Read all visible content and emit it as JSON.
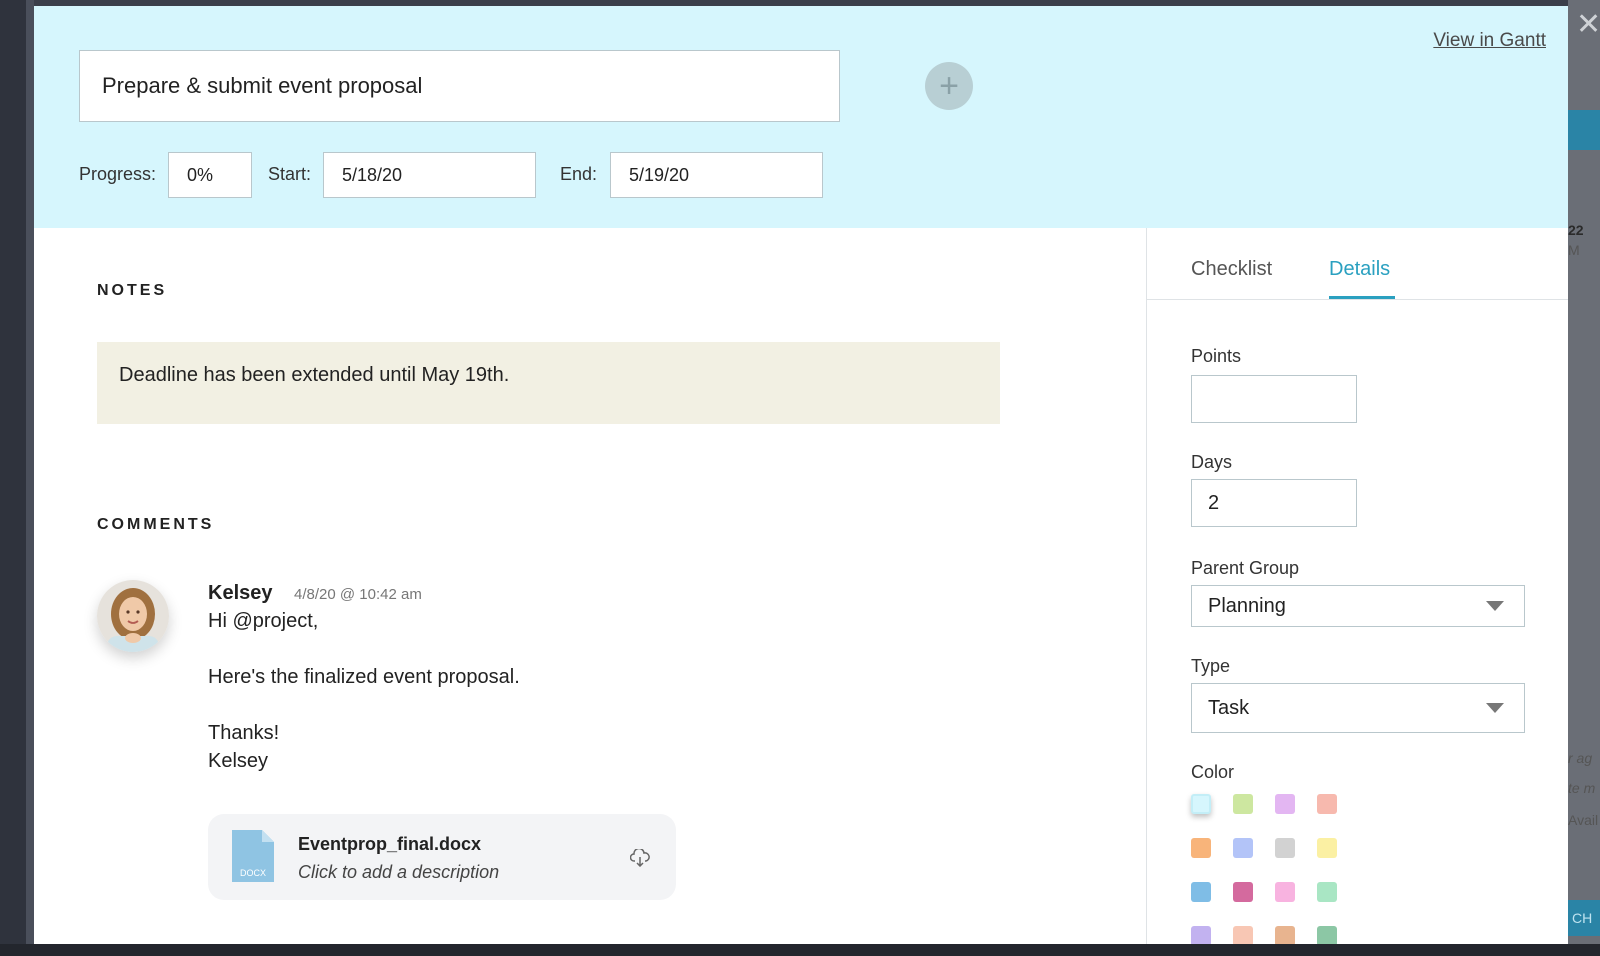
{
  "header": {
    "task_title": "Prepare & submit event proposal",
    "add_label": "+",
    "view_gantt": "View in Gantt",
    "progress_label": "Progress:",
    "progress_value": "0%",
    "start_label": "Start:",
    "start_value": "5/18/20",
    "end_label": "End:",
    "end_value": "5/19/20"
  },
  "notes": {
    "title": "NOTES",
    "text": "Deadline has been extended until May 19th."
  },
  "comments": {
    "title": "COMMENTS",
    "items": [
      {
        "author": "Kelsey",
        "timestamp": "4/8/20 @ 10:42 am",
        "lines": [
          "Hi @project,",
          "Here's the finalized event proposal.",
          "Thanks!",
          "Kelsey"
        ],
        "attachment": {
          "type_badge": "DOCX",
          "filename": "Eventprop_final.docx",
          "description": "Click to add a description"
        }
      }
    ]
  },
  "right_panel": {
    "tabs": [
      {
        "label": "Checklist",
        "active": false
      },
      {
        "label": "Details",
        "active": true
      }
    ],
    "points_label": "Points",
    "points_value": "",
    "days_label": "Days",
    "days_value": "2",
    "parent_group_label": "Parent Group",
    "parent_group_value": "Planning",
    "type_label": "Type",
    "type_value": "Task",
    "color_label": "Color",
    "colors": [
      [
        "#d6f6fd",
        "#cde7a0",
        "#e3b6f2",
        "#f7b9ae"
      ],
      [
        "#f8b47a",
        "#b3c4f8",
        "#d2d2d2",
        "#fbf0a3"
      ],
      [
        "#7fbde6",
        "#d46a9e",
        "#f8b3e0",
        "#a9e6c4"
      ],
      [
        "#c2b2f0",
        "#f8c7b4",
        "#e8b48f",
        "#8cc7a5"
      ]
    ],
    "selected_color": "#d6f6fd"
  },
  "background": {
    "right_number": "22",
    "right_sub": "M",
    "right_text_1": "r ag",
    "right_text_2": "te m",
    "right_text_3": "Avail",
    "right_button": "CH"
  }
}
